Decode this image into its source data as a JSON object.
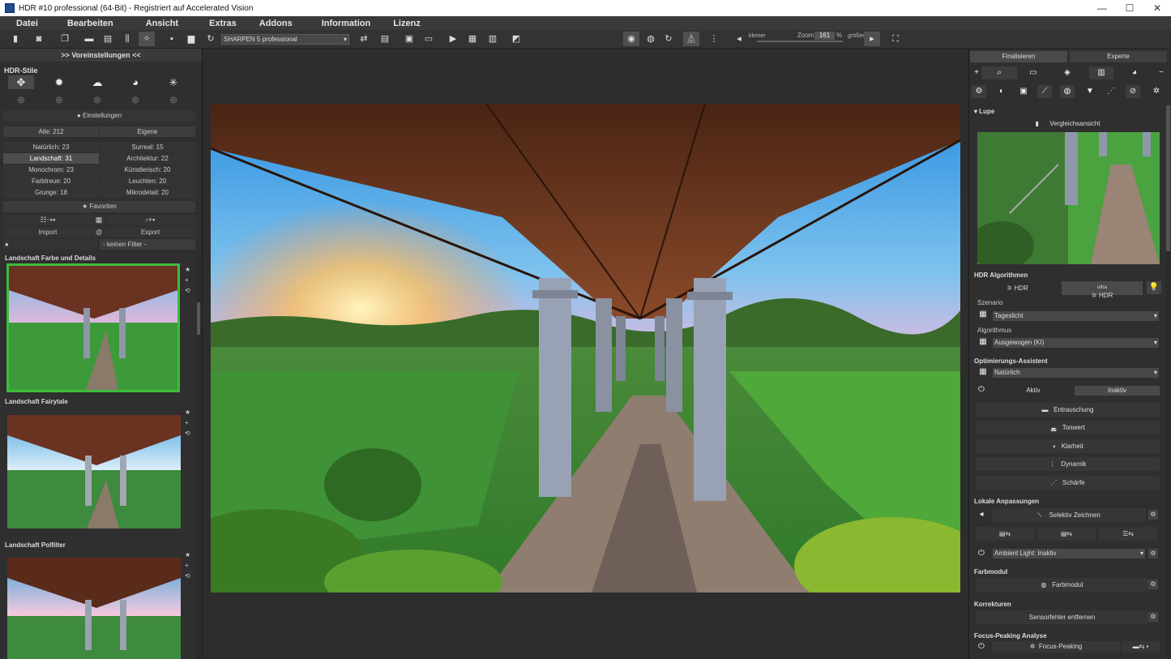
{
  "window": {
    "title": "HDR #10 professional (64-Bit) - Registriert auf Accelerated Vision",
    "controls": [
      "—",
      "☐",
      "✕"
    ]
  },
  "menu": [
    "Datei",
    "Bearbeiten",
    "Ansicht",
    "Extras",
    "Addons",
    "Information",
    "Lizenz"
  ],
  "toolbar": {
    "preset_select": "SHARPEN 5 professional",
    "zoom_label": "Zoom",
    "zoom_value": "161",
    "zoom_unit": "%",
    "smaller": "kleiner",
    "larger": "größer"
  },
  "left": {
    "header": ">> Voreinstellungen <<",
    "styles_title": "HDR-Stile",
    "settings": "Einstellungen",
    "tabs": {
      "all": "Alle: 212",
      "own": "Eigene"
    },
    "categories": [
      [
        "Natürlich: 23",
        "Surreal: 15"
      ],
      [
        "Landschaft: 31",
        "Architektur: 22"
      ],
      [
        "Monochrom: 23",
        "Künstlerisch: 20"
      ],
      [
        "Farbtreue: 20",
        "Leuchten: 20"
      ],
      [
        "Grunge: 18",
        "Mikrodetail: 20"
      ]
    ],
    "favorites": "★ Favoriten",
    "import": "Import",
    "at": "@",
    "export": "Export",
    "filter": "- keinen Filter -",
    "presets": [
      "Landschaft Farbe und Details",
      "Landschaft Fairytale",
      "Landschaft Polfilter"
    ]
  },
  "right": {
    "tabs": [
      "Finalisieren",
      "Experte"
    ],
    "lupe": "Lupe",
    "compare": "Vergleichsansicht",
    "hdr_algorithms": "HDR Algorithmen",
    "hdr": "HDR",
    "ultra_hdr_top": "ultra",
    "ultra_hdr": "HDR",
    "scenario_label": "Szenario",
    "scenario": "Tageslicht",
    "algorithm_label": "Algorithmus",
    "algorithm": "Ausgewogen (KI)",
    "assistant": "Optimierungs-Assistent",
    "assistant_value": "Natürlich",
    "active": "Aktiv",
    "inactive": "Inaktiv",
    "modules": [
      "Entrauschung",
      "Tonwert",
      "Klarheit",
      "Dynamik",
      "Schärfe"
    ],
    "local": "Lokale Anpassungen",
    "selective": "Selektiv Zeichnen",
    "ambient": "Ambient Light: Inaktiv",
    "colormodule_title": "Farbmodul",
    "colormodule": "Farbmodul",
    "corrections_title": "Korrekturen",
    "sensor": "Sensorfehler entfernen",
    "focus_title": "Focus-Peaking Analyse",
    "focus": "Focus-Peaking"
  }
}
